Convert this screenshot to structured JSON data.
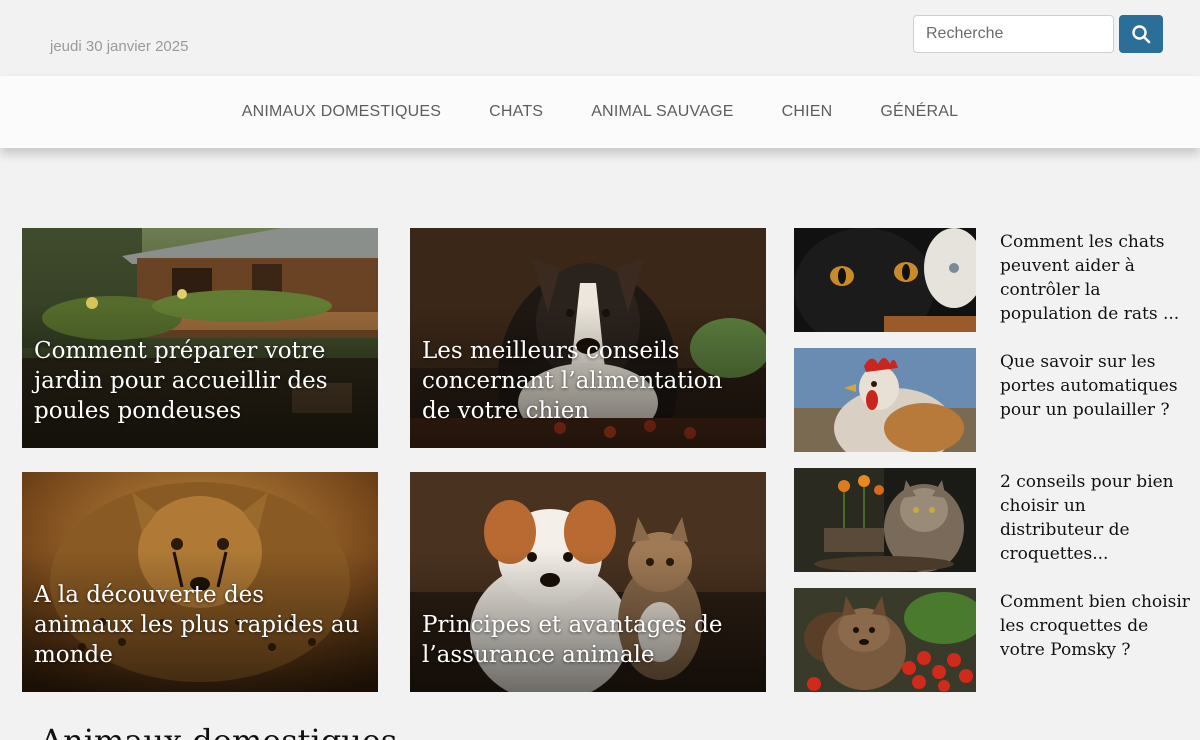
{
  "header": {
    "date": "jeudi 30 janvier 2025",
    "search_placeholder": "Recherche"
  },
  "nav": {
    "items": [
      "ANIMAUX DOMESTIQUES",
      "CHATS",
      "ANIMAL SAUVAGE",
      "CHIEN",
      "GÉNÉRAL"
    ]
  },
  "featured": [
    {
      "title": "Comment préparer votre jardin pour accueillir des poules pondeuses"
    },
    {
      "title": "Les meilleurs conseils concernant l’alimentation de votre chien"
    },
    {
      "title": "A la découverte des animaux les plus rapides au monde"
    },
    {
      "title": "Principes et avantages de l’assurance animale"
    }
  ],
  "sidebar": [
    {
      "title": "Comment les chats peuvent aider à contrôler la population de rats ..."
    },
    {
      "title": "Que savoir sur les portes automatiques pour un poulailler ?"
    },
    {
      "title": "2 conseils pour bien choisir un distributeur de croquettes..."
    },
    {
      "title": "Comment bien choisir les croquettes de votre Pomsky ?"
    }
  ],
  "section": {
    "title": "Animaux domestiques"
  },
  "colors": {
    "accent": "#2b6f99",
    "nav_text": "#5d5d5d",
    "date_text": "#9a9a9a"
  }
}
